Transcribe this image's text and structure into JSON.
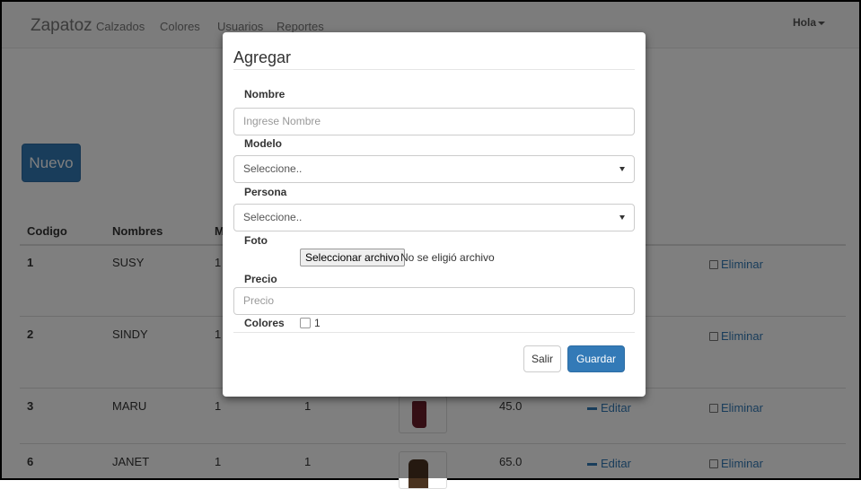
{
  "navbar": {
    "brand": "Zapatoz",
    "links": [
      "Calzados",
      "Colores",
      "Usuarios",
      "Reportes"
    ],
    "user_menu": "Hola"
  },
  "page": {
    "nuevo_label": "Nuevo"
  },
  "table": {
    "headers": [
      "Codigo",
      "Nombres",
      "M"
    ],
    "rows": [
      {
        "codigo": "1",
        "nombre": "SUSY",
        "col3": "1",
        "col4": "",
        "precio": "",
        "editar": "",
        "eliminar": "Eliminar"
      },
      {
        "codigo": "2",
        "nombre": "SINDY",
        "col3": "1",
        "col4": "",
        "precio": "",
        "editar": "",
        "eliminar": "Eliminar"
      },
      {
        "codigo": "3",
        "nombre": "MARU",
        "col3": "1",
        "col4": "1",
        "precio": "45.0",
        "editar": "Editar",
        "eliminar": "Eliminar"
      },
      {
        "codigo": "6",
        "nombre": "JANET",
        "col3": "1",
        "col4": "1",
        "precio": "65.0",
        "editar": "Editar",
        "eliminar": "Eliminar"
      }
    ]
  },
  "modal": {
    "title": "Agregar",
    "nombre_label": "Nombre",
    "nombre_placeholder": "Ingrese Nombre",
    "modelo_label": "Modelo",
    "modelo_value": "Seleccione..",
    "persona_label": "Persona",
    "persona_value": "Seleccione..",
    "foto_label": "Foto",
    "file_button": "Seleccionar archivo",
    "file_status": "No se eligió archivo",
    "precio_label": "Precio",
    "precio_placeholder": "Precio",
    "colores_label": "Colores",
    "color_option": "1",
    "salir_label": "Salir",
    "guardar_label": "Guardar"
  },
  "colors": {
    "primary": "#337ab7",
    "overlay": "rgba(0,0,0,0.5)"
  }
}
